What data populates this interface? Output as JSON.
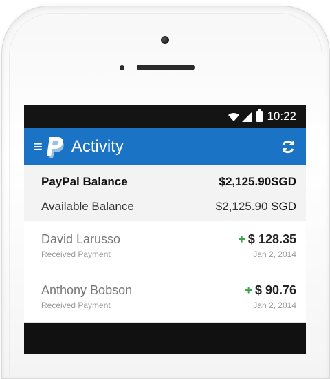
{
  "status_bar": {
    "time": "10:22",
    "icons": [
      "wifi-icon",
      "signal-icon",
      "battery-icon"
    ]
  },
  "app_bar": {
    "title": "Activity",
    "icons": [
      "menu-icon",
      "paypal-logo",
      "refresh-icon"
    ],
    "color": "#1a73c5"
  },
  "balance": {
    "paypal_label": "PayPal Balance",
    "paypal_amount": "$2,125.90",
    "paypal_currency": "SGD",
    "available_label": "Available Balance",
    "available_amount": "$2,125.90",
    "available_currency": "SGD"
  },
  "transactions": [
    {
      "name": "David Larusso",
      "type": "Received Payment",
      "sign": "+",
      "amount": "$ 128.35",
      "date": "Jan 2, 2014"
    },
    {
      "name": "Anthony Bobson",
      "type": "Received Payment",
      "sign": "+",
      "amount": "$ 90.76",
      "date": "Jan 2, 2014"
    }
  ]
}
